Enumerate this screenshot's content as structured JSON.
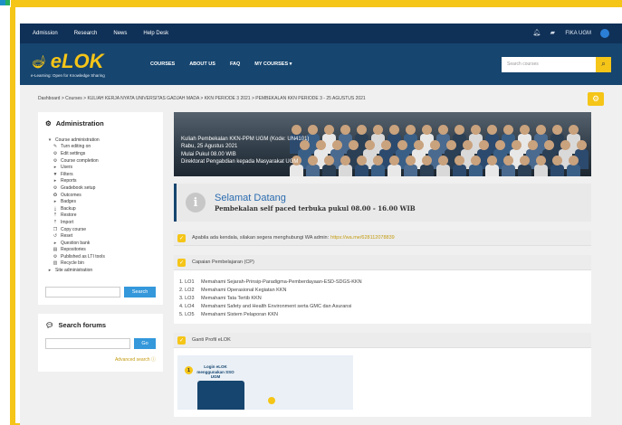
{
  "topbar": {
    "nav": [
      "Admission",
      "Research",
      "News",
      "Help Desk"
    ],
    "user_name": "FIKA UGM"
  },
  "header": {
    "logo_text": "eLOK",
    "logo_tagline": "e-Learning: Open for Knowledge Sharing",
    "nav": [
      "COURSES",
      "ABOUT US",
      "FAQ",
      "MY COURSES"
    ],
    "search_placeholder": "Search courses"
  },
  "breadcrumb": "Dashboard > Courses > KULIAH KERJA NYATA UNIVERSITAS GADJAH MADA > KKN PERIODE 3 2021 > PEMBEKALAN KKN PERIODE 3 - 25 AGUSTUS 2021",
  "admin_block": {
    "title": "Administration",
    "items": [
      {
        "label": "Course administration",
        "glyph": "▾",
        "level": 1
      },
      {
        "label": "Turn editing on",
        "glyph": "✎",
        "level": 2
      },
      {
        "label": "Edit settings",
        "glyph": "⚙",
        "level": 2
      },
      {
        "label": "Course completion",
        "glyph": "⚙",
        "level": 2
      },
      {
        "label": "Users",
        "glyph": "▸",
        "level": 2
      },
      {
        "label": "Filters",
        "glyph": "▼",
        "level": 2
      },
      {
        "label": "Reports",
        "glyph": "▸",
        "level": 2
      },
      {
        "label": "Gradebook setup",
        "glyph": "⚙",
        "level": 2
      },
      {
        "label": "Outcomes",
        "glyph": "✪",
        "level": 2
      },
      {
        "label": "Badges",
        "glyph": "▸",
        "level": 2
      },
      {
        "label": "Backup",
        "glyph": "⤓",
        "level": 2
      },
      {
        "label": "Restore",
        "glyph": "⤒",
        "level": 2
      },
      {
        "label": "Import",
        "glyph": "⤒",
        "level": 2
      },
      {
        "label": "Copy course",
        "glyph": "❐",
        "level": 2
      },
      {
        "label": "Reset",
        "glyph": "↺",
        "level": 2
      },
      {
        "label": "Question bank",
        "glyph": "▸",
        "level": 2
      },
      {
        "label": "Repositories",
        "glyph": "▤",
        "level": 2
      },
      {
        "label": "Published as LTI tools",
        "glyph": "⚙",
        "level": 2
      },
      {
        "label": "Recycle bin",
        "glyph": "▥",
        "level": 2
      },
      {
        "label": "Site administration",
        "glyph": "▸",
        "level": 1
      }
    ],
    "search_button": "Search"
  },
  "forums_block": {
    "title": "Search forums",
    "go_button": "Go",
    "advanced_search": "Advanced search"
  },
  "banner": {
    "line1": "Kuliah Pembekalan KKN-PPM UGM (Kode: UN4101)",
    "line2": "Rabu, 25 Agustus 2021",
    "line3": "Mulai Pukul 08.00 WIB",
    "line4": "Direktorat Pengabdian kepada Masyarakat UGM"
  },
  "welcome": {
    "title": "Selamat Datang",
    "subtitle": "Pembekalan self paced terbuka pukul 08.00 - 16.00 WIB"
  },
  "contact": {
    "text": "Apabila ada kendala, silakan segera menghubungi WA admin:",
    "link": "https://wa.me/628112078839"
  },
  "cp_section": {
    "title": "Capaian Pembelajaran (CP)",
    "items": [
      {
        "code": "1. LO1",
        "text": "Memahami Sejarah-Prinsip-Paradigma-Pemberdayaan-ESD-SDGS-KKN"
      },
      {
        "code": "2. LO2",
        "text": "Memahami Operasional Kegiatan KKN"
      },
      {
        "code": "3. LO3",
        "text": "Memahami Tata Tertib KKN"
      },
      {
        "code": "4. LO4",
        "text": "Memahami Safety and Health Environment serta GMC dan Asuransi"
      },
      {
        "code": "5. LO5",
        "text": "Memahami Sistem Pelaporan KKN"
      }
    ]
  },
  "profile_section": {
    "title": "Ganti Profil eLOK",
    "poster_step": "1",
    "poster_label": "Login eLOK menggunakan SSO UGM"
  }
}
